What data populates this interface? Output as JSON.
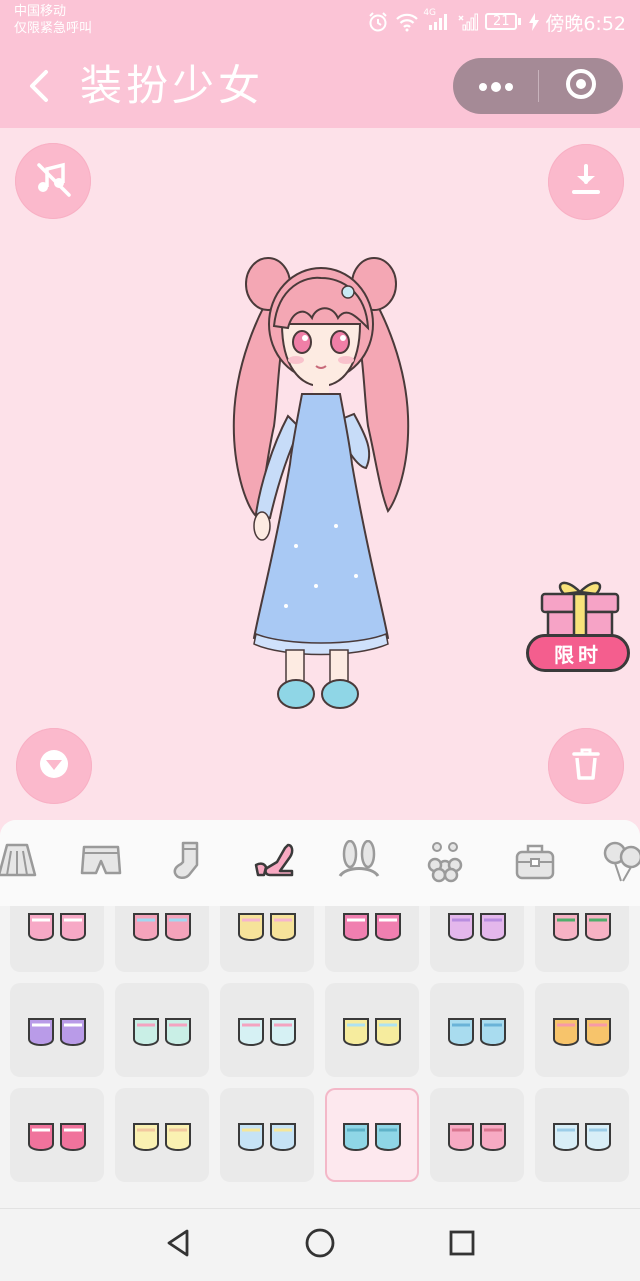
{
  "status_bar": {
    "carrier_line1": "中国移动",
    "carrier_line2": "仅限紧急呼叫",
    "net_4g": "4G",
    "battery": "21",
    "time": "傍晚6:52"
  },
  "header": {
    "title": "装扮少女",
    "back_icon": "chevron-left-icon",
    "more_icon": "more-dots-icon",
    "close_icon": "target-close-icon"
  },
  "stage": {
    "music_icon": "music-off-icon",
    "download_icon": "download-icon",
    "collapse_icon": "triangle-down-icon",
    "delete_icon": "trash-icon",
    "gift_icon": "gift-box-icon",
    "gift_label": "限时"
  },
  "categories": [
    {
      "name": "skirt",
      "icon": "skirt-icon"
    },
    {
      "name": "shorts",
      "icon": "shorts-icon"
    },
    {
      "name": "socks",
      "icon": "sock-icon"
    },
    {
      "name": "shoes",
      "icon": "high-heel-icon",
      "active": true
    },
    {
      "name": "headwear",
      "icon": "bunny-ears-icon"
    },
    {
      "name": "accessory",
      "icon": "flower-icon"
    },
    {
      "name": "bag",
      "icon": "bag-icon"
    },
    {
      "name": "balloon",
      "icon": "balloon-icon"
    }
  ],
  "shoe_items": [
    {
      "color": "#f7a9c6",
      "accent": "#ffffff"
    },
    {
      "color": "#f4a3bb",
      "accent": "#9fd8f0"
    },
    {
      "color": "#f6e39a",
      "accent": "#f6b5cf"
    },
    {
      "color": "#f07fb0",
      "accent": "#ffffff"
    },
    {
      "color": "#e4b7ec",
      "accent": "#b98de0"
    },
    {
      "color": "#f7b2c4",
      "accent": "#4fae6b"
    },
    {
      "color": "#b99be8",
      "accent": "#ffffff"
    },
    {
      "color": "#c9efe6",
      "accent": "#f4a3c0"
    },
    {
      "color": "#d6f1f4",
      "accent": "#f4a3c0"
    },
    {
      "color": "#f6ec9e",
      "accent": "#aee2f2"
    },
    {
      "color": "#a9dcef",
      "accent": "#6ab3d8"
    },
    {
      "color": "#f7c46b",
      "accent": "#f79aa8"
    },
    {
      "color": "#f0739c",
      "accent": "#ffffff"
    },
    {
      "color": "#faf1b2",
      "accent": "#f3c8a0"
    },
    {
      "color": "#c6e3f5",
      "accent": "#f6e79a"
    },
    {
      "color": "#8fd6e6",
      "accent": "#5fb2c8",
      "selected": true
    },
    {
      "color": "#f7aac3",
      "accent": "#d9758f"
    },
    {
      "color": "#d8eef7",
      "accent": "#9ccde8"
    }
  ],
  "nav_bar": {
    "back_icon": "triangle-back-icon",
    "home_icon": "circle-home-icon",
    "recents_icon": "square-recents-icon"
  }
}
